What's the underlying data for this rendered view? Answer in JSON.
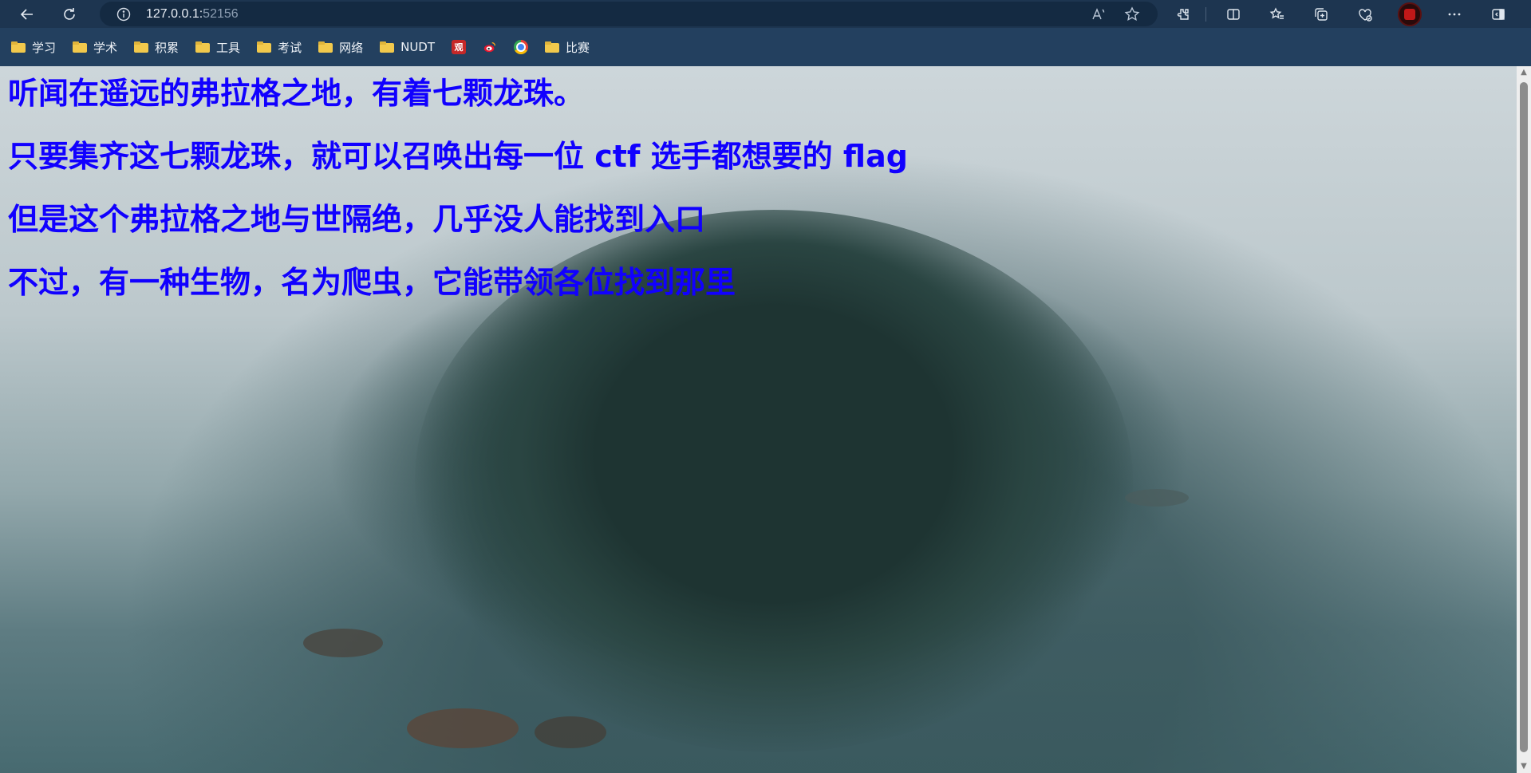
{
  "browser": {
    "url_host": "127.0.0.1:",
    "url_port": "52156"
  },
  "bookmarks": [
    {
      "label": "学习",
      "type": "folder"
    },
    {
      "label": "学术",
      "type": "folder"
    },
    {
      "label": "积累",
      "type": "folder"
    },
    {
      "label": "工具",
      "type": "folder"
    },
    {
      "label": "考试",
      "type": "folder"
    },
    {
      "label": "网络",
      "type": "folder"
    },
    {
      "label": "NUDT",
      "type": "folder"
    },
    {
      "label": "",
      "type": "site-guan",
      "badge": "观"
    },
    {
      "label": "",
      "type": "site-weibo"
    },
    {
      "label": "",
      "type": "site-chrome"
    },
    {
      "label": "比赛",
      "type": "folder"
    }
  ],
  "page": {
    "lines": [
      "听闻在遥远的弗拉格之地，有着七颗龙珠。",
      "只要集齐这七颗龙珠，就可以召唤出每一位 ctf 选手都想要的 flag",
      "但是这个弗拉格之地与世隔绝，几乎没人能找到入口",
      "不过，有一种生物，名为爬虫，它能带领各位找到那里"
    ],
    "text_color": "#1100ff"
  }
}
